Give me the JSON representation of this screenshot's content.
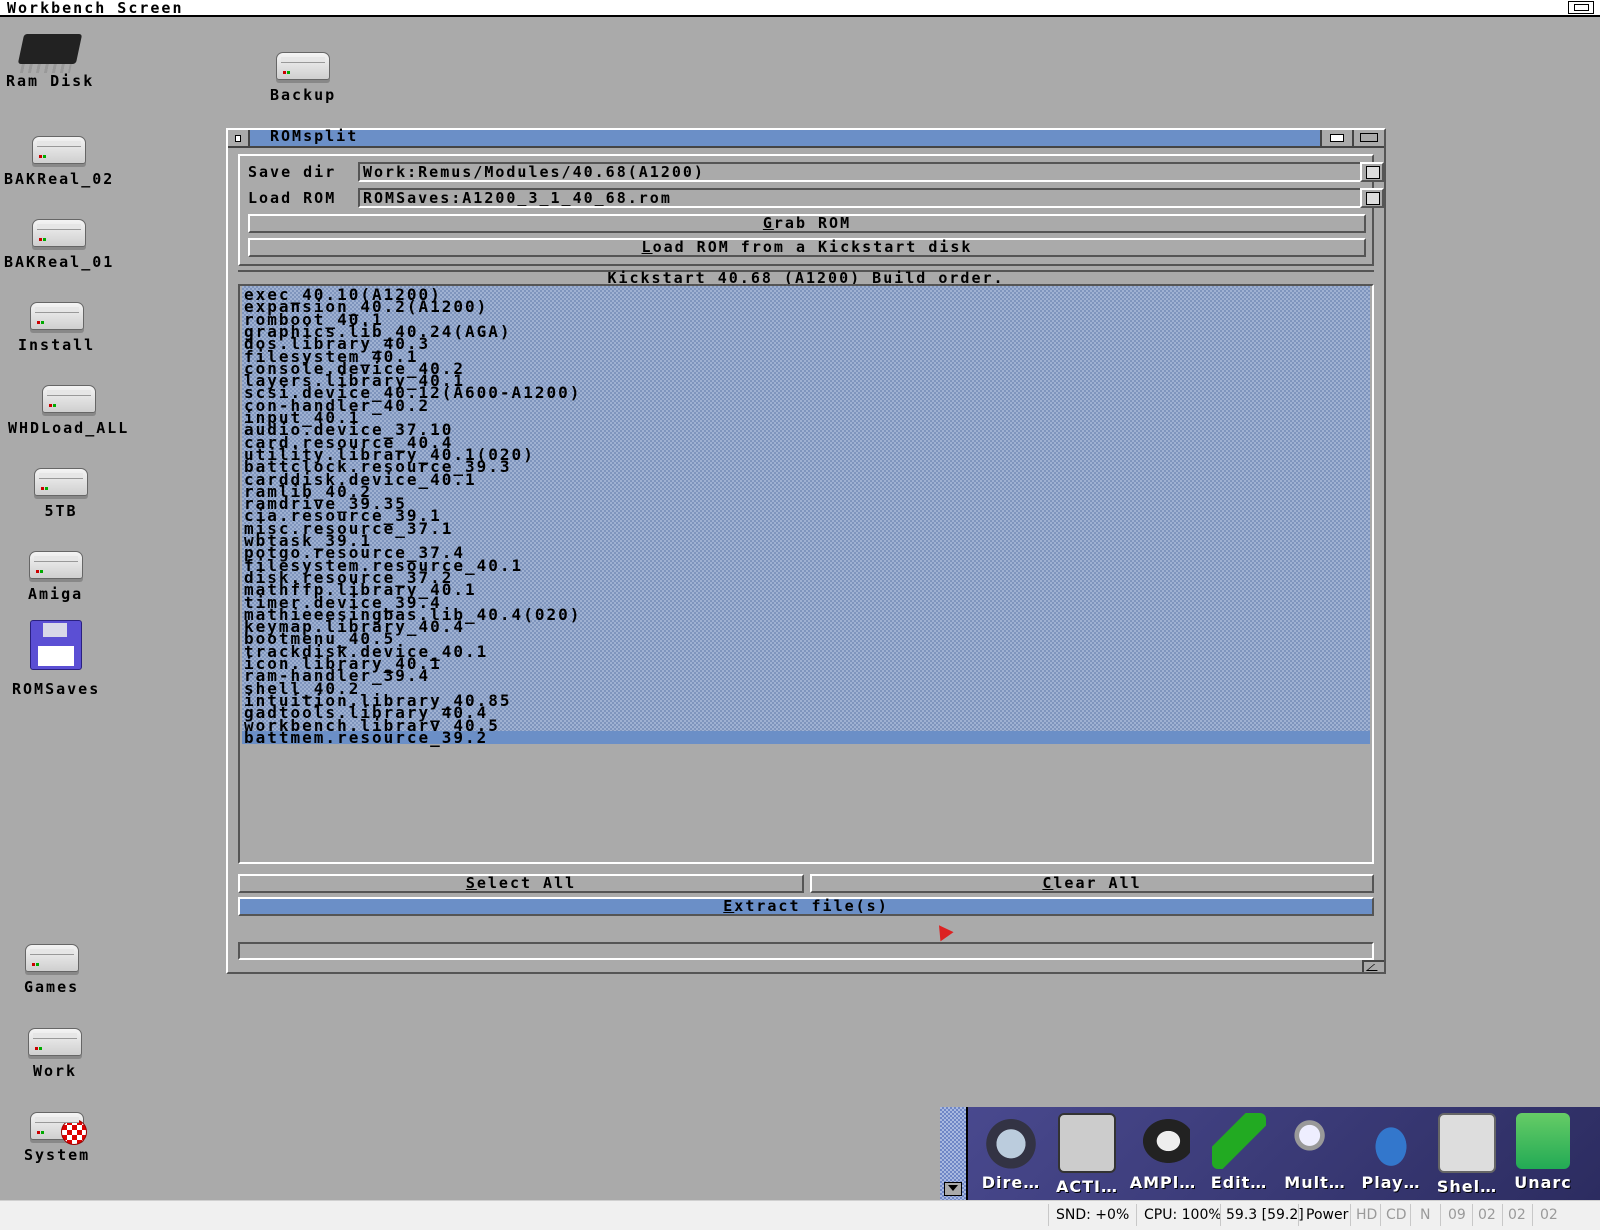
{
  "screen": {
    "title": "Workbench Screen"
  },
  "desktop_icons": [
    {
      "label": "Ram Disk",
      "type": "chip"
    },
    {
      "label": "Backup",
      "type": "drive"
    },
    {
      "label": "BAKReal_02",
      "type": "drive"
    },
    {
      "label": "BAKReal_01",
      "type": "drive"
    },
    {
      "label": "Install",
      "type": "drive"
    },
    {
      "label": "WHDLoad_ALL",
      "type": "drive"
    },
    {
      "label": "5TB",
      "type": "drive"
    },
    {
      "label": "Amiga",
      "type": "drive"
    },
    {
      "label": "ROMSaves",
      "type": "floppy"
    },
    {
      "label": "Games",
      "type": "drive"
    },
    {
      "label": "Work",
      "type": "drive"
    },
    {
      "label": "System",
      "type": "drive-ball"
    }
  ],
  "window": {
    "title": "ROMsplit",
    "save_dir_label": "Save dir",
    "save_dir_value": "Work:Remus/Modules/40.68(A1200)",
    "load_rom_label": "Load ROM",
    "load_rom_value": "ROMSaves:A1200_3_1_40_68.rom",
    "grab_rom_hotkey": "G",
    "grab_rom_rest": "rab ROM",
    "load_kick_hotkey": "L",
    "load_kick_rest": "oad ROM from a Kickstart disk",
    "list_header": "Kickstart 40.68 (A1200) Build order.",
    "modules": [
      "exec_40.10(A1200)",
      "expansion_40.2(A1200)",
      "romboot_40.1",
      "graphics.lib_40.24(AGA)",
      "dos.library_40.3",
      "filesystem_40.1",
      "console.device_40.2",
      "layers.library_40.1",
      "scsi.device_40.12(A600-A1200)",
      "con-handler_40.2",
      "input_40.1",
      "audio.device_37.10",
      "card.resource_40.4",
      "utility.library_40.1(020)",
      "battclock.resource_39.3",
      "carddisk.device_40.1",
      "ramlib_40.2",
      "ramdrive_39.35",
      "cia.resource_39.1",
      "misc.resource_37.1",
      "wbtask_39.1",
      "potgo.resource_37.4",
      "filesystem.resource_40.1",
      "disk.resource_37.2",
      "mathffp.library_40.1",
      "timer.device_39.4",
      "mathieeesingbas.lib_40.4(020)",
      "keymap.library_40.4",
      "bootmenu_40.5",
      "trackdisk.device_40.1",
      "icon.library_40.1",
      "ram-handler_39.4",
      "shell_40.2",
      "intuition.library_40.85",
      "gadtools.library_40.4",
      "workbench.library_40.5",
      "battmem.resource_39.2"
    ],
    "select_all_hotkey": "S",
    "select_all_rest": "elect All",
    "clear_all_hotkey": "C",
    "clear_all_rest": "lear All",
    "extract_hotkey": "E",
    "extract_rest": "xtract file(s)"
  },
  "dock": [
    {
      "label": "Dire…",
      "icon": "directory-opus-icon"
    },
    {
      "label": "ACTI…",
      "icon": "activity-icon"
    },
    {
      "label": "AMPl…",
      "icon": "speaker-icon"
    },
    {
      "label": "Edit…",
      "icon": "pencil-icon"
    },
    {
      "label": "Mult…",
      "icon": "magnifier-icon"
    },
    {
      "label": "Play…",
      "icon": "disc-player-icon"
    },
    {
      "label": "Shel…",
      "icon": "shell-icon"
    },
    {
      "label": "Unarc",
      "icon": "box-icon"
    }
  ],
  "statusbar": {
    "snd": "SND: +0%",
    "cpu": "CPU: 100%",
    "fps": "59.3 [59.2]",
    "power": "Power",
    "hd": "HD",
    "cd": "CD",
    "n": "N",
    "d0": "09",
    "d1": "02",
    "d2": "02",
    "d3": "02"
  },
  "colors": {
    "desktop": "#aaaaaa",
    "accent": "#6b8fc7"
  }
}
